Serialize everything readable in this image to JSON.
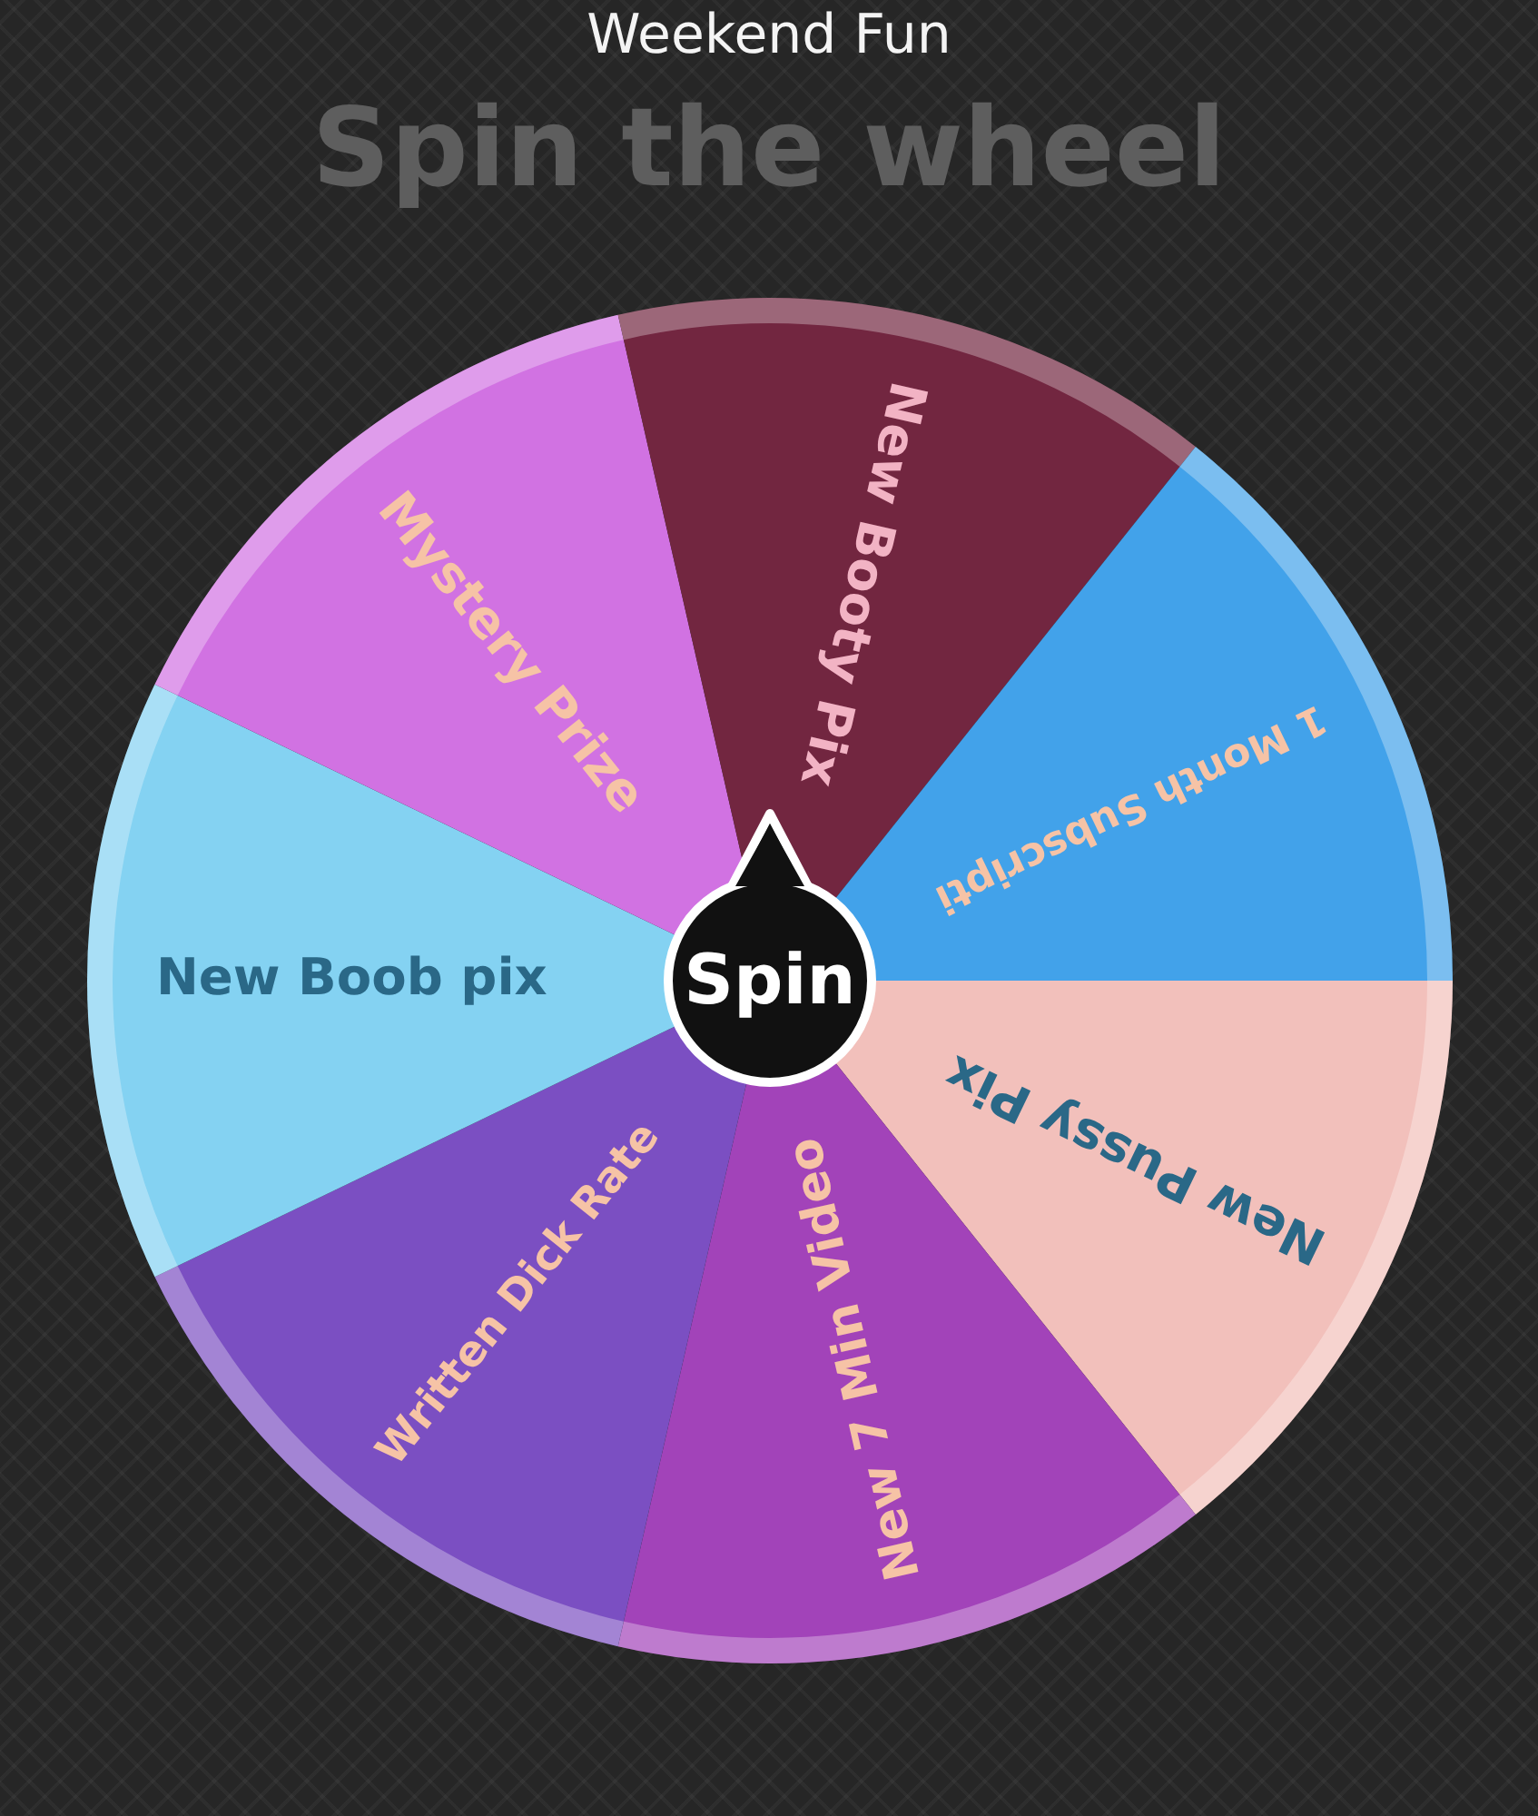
{
  "header": {
    "title": "Weekend Fun",
    "heading": "Spin the wheel"
  },
  "wheel": {
    "button": "Spin",
    "segments": [
      {
        "label": "New Pussy Pix",
        "color": "#f2c0bb"
      },
      {
        "label": "New 7 Min Video",
        "color": "#a243b9"
      },
      {
        "label": "Written Dick Rate",
        "color": "#7b4fc2"
      },
      {
        "label": "New Boob pix",
        "color": "#84d2f2"
      },
      {
        "label": "Mystery Prize",
        "color": "#d172e2"
      },
      {
        "label": "New Booty Pix",
        "color": "#722640"
      },
      {
        "label": "1 Month Subscripti",
        "color": "#42a2ea"
      }
    ]
  }
}
